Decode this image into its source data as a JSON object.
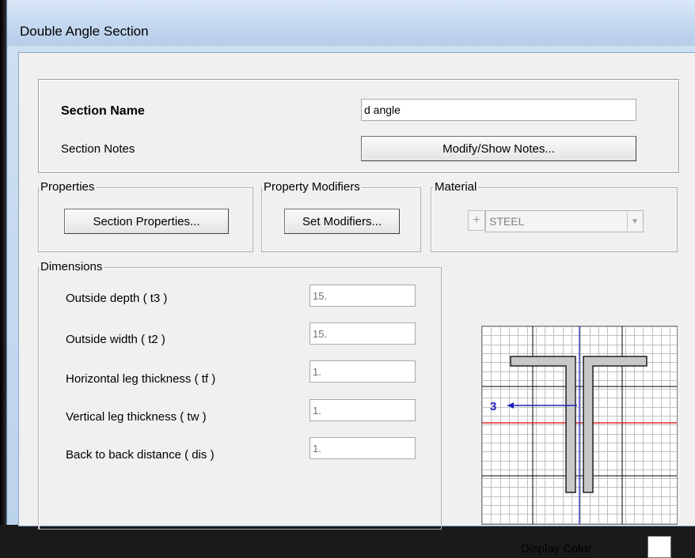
{
  "window": {
    "title": "Double Angle Section"
  },
  "section": {
    "name_label": "Section Name",
    "name_value": "d angle",
    "notes_label": "Section Notes",
    "notes_button": "Modify/Show Notes..."
  },
  "properties": {
    "group_title": "Properties",
    "button": "Section Properties..."
  },
  "modifiers": {
    "group_title": "Property Modifiers",
    "button": "Set Modifiers..."
  },
  "material": {
    "group_title": "Material",
    "plus": "+",
    "selected": "STEEL"
  },
  "dimensions": {
    "group_title": "Dimensions",
    "fields": [
      {
        "label": "Outside depth  ( t3 )",
        "value": "15."
      },
      {
        "label": "Outside width  ( t2 )",
        "value": "15."
      },
      {
        "label": "Horizontal leg thickness  ( tf )",
        "value": "1."
      },
      {
        "label": "Vertical leg thickness  ( tw )",
        "value": "1."
      },
      {
        "label": "Back to back distance  ( dis )",
        "value": "1."
      }
    ]
  },
  "preview": {
    "axis_label": "3",
    "grid_color": "#c0c0c0",
    "axis_color_vertical": "#2020c0",
    "axis_color_horizontal": "#e00000",
    "section_fill": "#c8c8c8"
  },
  "display_color": {
    "label": "Display Color",
    "color": "#ffffff"
  }
}
